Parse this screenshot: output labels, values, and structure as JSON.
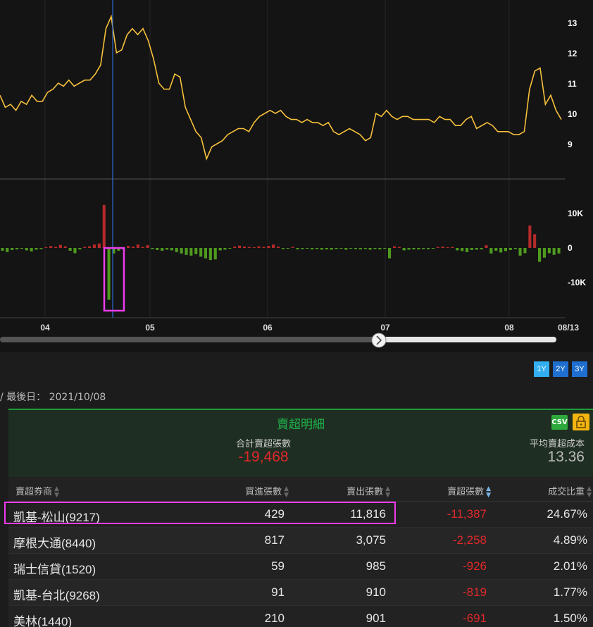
{
  "chart": {
    "price_ticks": [
      "13",
      "12",
      "11",
      "10",
      "9"
    ],
    "volume_ticks": [
      "10K",
      "0",
      "-10K"
    ],
    "month_labels": [
      "04",
      "05",
      "06",
      "07",
      "08",
      "08/13"
    ],
    "colors": {
      "price_line": "#f6c03a",
      "positive_bar": "#b42a2a",
      "negative_bar": "#4e9a1f",
      "cursor_line": "#2e6bd8",
      "highlight": "#ee3cee"
    },
    "price_series": [
      10.6,
      10.2,
      10.3,
      10.1,
      10.4,
      10.3,
      10.6,
      10.4,
      10.4,
      10.7,
      10.8,
      11.0,
      10.9,
      11.1,
      10.9,
      11.0,
      11.1,
      11.1,
      11.3,
      11.6,
      12.8,
      13.2,
      12.0,
      12.1,
      12.6,
      12.8,
      12.6,
      12.8,
      12.4,
      11.8,
      11.0,
      10.8,
      10.8,
      11.3,
      11.2,
      10.2,
      9.8,
      9.4,
      9.2,
      8.5,
      8.9,
      9.0,
      9.1,
      9.3,
      9.4,
      9.5,
      9.5,
      9.4,
      9.7,
      9.9,
      10.0,
      10.1,
      10.0,
      10.1,
      9.9,
      9.8,
      9.8,
      9.7,
      9.8,
      9.7,
      9.7,
      9.6,
      9.7,
      9.4,
      9.3,
      9.4,
      9.5,
      9.4,
      9.3,
      9.1,
      9.2,
      10.0,
      9.9,
      10.1,
      9.9,
      9.8,
      9.9,
      9.9,
      9.8,
      9.8,
      9.8,
      9.8,
      9.7,
      9.9,
      9.8,
      9.8,
      9.6,
      9.6,
      9.8,
      9.9,
      9.5,
      9.6,
      9.7,
      9.6,
      9.4,
      9.4,
      9.4,
      9.3,
      9.3,
      9.4,
      10.8,
      11.4,
      11.5,
      10.3,
      10.6,
      10.1,
      9.8
    ],
    "volume_series": [
      -800,
      -1200,
      -600,
      -400,
      -200,
      -700,
      -1000,
      -500,
      -300,
      200,
      600,
      300,
      900,
      500,
      -800,
      -1500,
      -400,
      300,
      500,
      1000,
      1300,
      12500,
      -15000,
      -1600,
      -800,
      -400,
      600,
      400,
      1000,
      300,
      800,
      -300,
      -600,
      -800,
      -500,
      -700,
      -1200,
      -1600,
      -2000,
      -2200,
      -1800,
      -2500,
      -3000,
      -3500,
      -3300,
      -700,
      -500,
      -200,
      400,
      700,
      400,
      300,
      200,
      500,
      300,
      600,
      1000,
      400,
      -300,
      -200,
      300,
      -400,
      -300,
      -200,
      -400,
      -300,
      -500,
      -400,
      -500,
      -300,
      -200,
      -500,
      -200,
      -300,
      -400,
      -300,
      -500,
      -300,
      -400,
      -200,
      -3000,
      500,
      300,
      -700,
      -500,
      -400,
      -400,
      -300,
      -300,
      -200,
      300,
      400,
      200,
      300,
      -700,
      -900,
      -1200,
      -600,
      -500,
      -400,
      800,
      -1600,
      -800,
      -1300,
      -900,
      -600,
      -300,
      -2200,
      -1500,
      6500,
      4000,
      -4000,
      -2800,
      -1500,
      -2000,
      -1600
    ]
  },
  "range_buttons": [
    "1Y",
    "2Y",
    "3Y"
  ],
  "last_date_text": "/ 最後日： 2021/10/08",
  "panel": {
    "title": "賣超明細",
    "csv_label": "CSV",
    "total_label": "合計賣超張數",
    "total_value": "-19,468",
    "avg_label": "平均賣超成本",
    "avg_value": "13.36"
  },
  "table": {
    "headers": {
      "broker": "賣超券商",
      "buy": "買進張數",
      "sell": "賣出張數",
      "net": "賣超張數",
      "ratio": "成交比重"
    },
    "rows": [
      {
        "broker": "凱基-松山(9217)",
        "buy": "429",
        "sell": "11,816",
        "net": "-11,387",
        "ratio": "24.67%"
      },
      {
        "broker": "摩根大通(8440)",
        "buy": "817",
        "sell": "3,075",
        "net": "-2,258",
        "ratio": "4.89%"
      },
      {
        "broker": "瑞士信貸(1520)",
        "buy": "59",
        "sell": "985",
        "net": "-926",
        "ratio": "2.01%"
      },
      {
        "broker": "凱基-台北(9268)",
        "buy": "91",
        "sell": "910",
        "net": "-819",
        "ratio": "1.77%"
      },
      {
        "broker": "美林(1440)",
        "buy": "210",
        "sell": "901",
        "net": "-691",
        "ratio": "1.50%"
      }
    ]
  }
}
